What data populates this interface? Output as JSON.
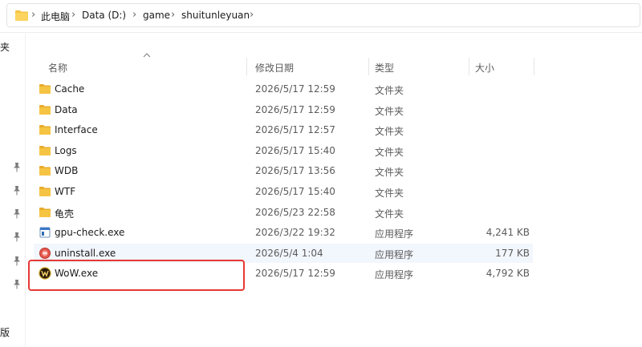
{
  "breadcrumb": {
    "items": [
      "此电脑",
      "Data (D:)",
      "game",
      "shuitunleyuan"
    ]
  },
  "nav": {
    "top_label": "夹",
    "bottom_label": "版"
  },
  "columns": {
    "name": "名称",
    "date": "修改日期",
    "type": "类型",
    "size": "大小"
  },
  "files": [
    {
      "name": "Cache",
      "date": "2026/5/17 12:59",
      "type": "文件夹",
      "size": "",
      "icon": "folder-icon"
    },
    {
      "name": "Data",
      "date": "2026/5/17 12:59",
      "type": "文件夹",
      "size": "",
      "icon": "folder-icon"
    },
    {
      "name": "Interface",
      "date": "2026/5/17 12:57",
      "type": "文件夹",
      "size": "",
      "icon": "folder-icon"
    },
    {
      "name": "Logs",
      "date": "2026/5/17 15:40",
      "type": "文件夹",
      "size": "",
      "icon": "folder-icon"
    },
    {
      "name": "WDB",
      "date": "2026/5/17 13:56",
      "type": "文件夹",
      "size": "",
      "icon": "folder-icon"
    },
    {
      "name": "WTF",
      "date": "2026/5/17 15:40",
      "type": "文件夹",
      "size": "",
      "icon": "folder-icon"
    },
    {
      "name": "龟壳",
      "date": "2026/5/23 22:58",
      "type": "文件夹",
      "size": "",
      "icon": "folder-icon"
    },
    {
      "name": "gpu-check.exe",
      "date": "2026/3/22 19:32",
      "type": "应用程序",
      "size": "4,241 KB",
      "icon": "exe-app-icon"
    },
    {
      "name": "uninstall.exe",
      "date": "2026/5/4 1:04",
      "type": "应用程序",
      "size": "177 KB",
      "icon": "uninstall-icon"
    },
    {
      "name": "WoW.exe",
      "date": "2026/5/17 12:59",
      "type": "应用程序",
      "size": "4,792 KB",
      "icon": "wow-icon"
    }
  ],
  "colors": {
    "folder": "#f6c443",
    "hover_row": "#f2f6fd",
    "highlight": "#e53935"
  }
}
